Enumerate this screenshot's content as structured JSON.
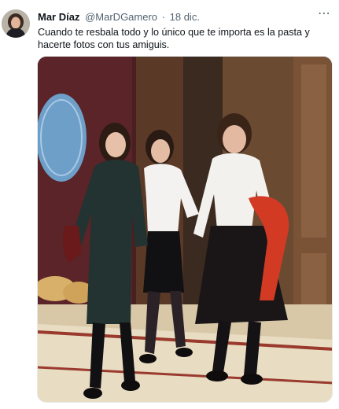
{
  "tweet": {
    "author_name": "Mar Díaz",
    "handle": "@MarDGamero",
    "separator": "·",
    "date": "18 dic.",
    "text": "Cuando te resbala todo y lo único que te importa es la pasta y hacerte fotos con tus amiguis.",
    "more_icon": "more-horizontal-icon",
    "more_label": "⋯"
  },
  "colors": {
    "text_primary": "#0f1419",
    "text_secondary": "#536471",
    "background": "#ffffff"
  }
}
